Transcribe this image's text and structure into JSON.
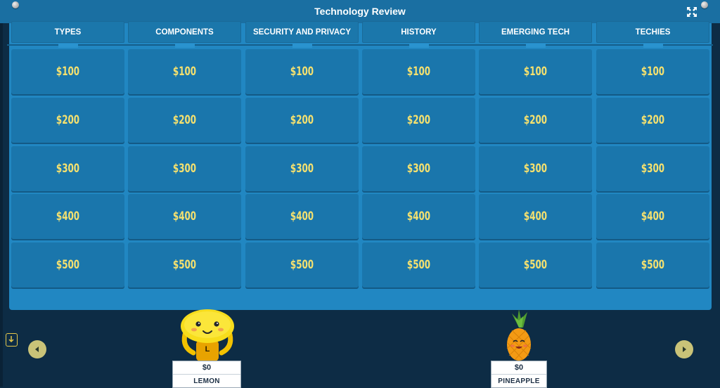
{
  "game": {
    "title": "Technology Review"
  },
  "colors": {
    "board": "#2187c2",
    "tile": "#1a76ac",
    "value_text": "#f5e16f",
    "background": "#0d2c45"
  },
  "icons": {
    "fullscreen": "fullscreen-icon",
    "prev": "chevron-left-icon",
    "next": "chevron-right-icon",
    "download": "download-icon"
  },
  "categories": [
    {
      "label": "TYPES",
      "values": [
        "$100",
        "$200",
        "$300",
        "$400",
        "$500"
      ]
    },
    {
      "label": "COMPONENTS",
      "values": [
        "$100",
        "$200",
        "$300",
        "$400",
        "$500"
      ]
    },
    {
      "label": "SECURITY AND PRIVACY",
      "values": [
        "$100",
        "$200",
        "$300",
        "$400",
        "$500"
      ]
    },
    {
      "label": "HISTORY",
      "values": [
        "$100",
        "$200",
        "$300",
        "$400",
        "$500"
      ]
    },
    {
      "label": "EMERGING TECH",
      "values": [
        "$100",
        "$200",
        "$300",
        "$400",
        "$500"
      ]
    },
    {
      "label": "TECHIES",
      "values": [
        "$100",
        "$200",
        "$300",
        "$400",
        "$500"
      ]
    }
  ],
  "players": [
    {
      "name": "LEMON",
      "score": "$0",
      "badge": "L"
    },
    {
      "name": "PINEAPPLE",
      "score": "$0"
    }
  ]
}
